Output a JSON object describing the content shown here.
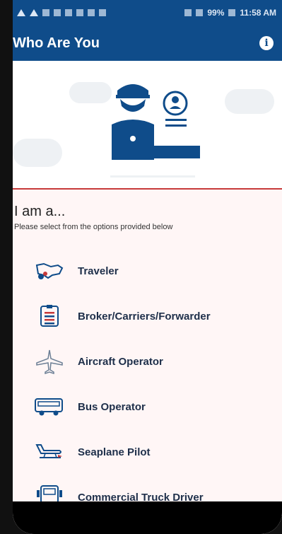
{
  "status_bar": {
    "battery": "99%",
    "time": "11:58 AM"
  },
  "app_bar": {
    "title": "Who Are You",
    "info_icon": "info-icon"
  },
  "colors": {
    "primary": "#0f4c8a",
    "divider": "#c73a3a",
    "background": "#fff6f6"
  },
  "prompt": {
    "heading": "I am a...",
    "subheading": "Please select from the options provided below"
  },
  "options": [
    {
      "label": "Traveler",
      "icon": "map-icon"
    },
    {
      "label": "Broker/Carriers/Forwarder",
      "icon": "document-icon"
    },
    {
      "label": "Aircraft Operator",
      "icon": "airplane-icon"
    },
    {
      "label": "Bus Operator",
      "icon": "bus-icon"
    },
    {
      "label": "Seaplane Pilot",
      "icon": "seaplane-icon"
    },
    {
      "label": "Commercial Truck Driver",
      "icon": "truck-icon"
    }
  ]
}
